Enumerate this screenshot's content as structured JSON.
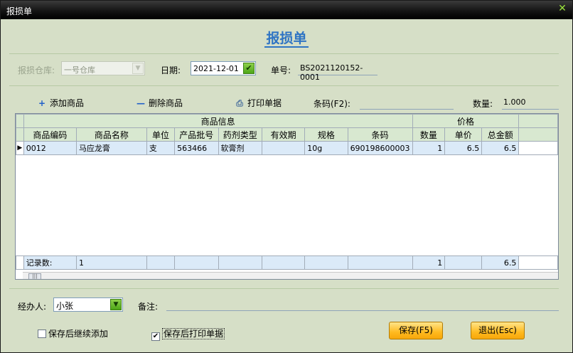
{
  "window": {
    "title": "报损单",
    "close_label": "✕"
  },
  "page_title": "报损单",
  "form": {
    "warehouse_label": "报损仓库:",
    "warehouse_value": "一号仓库",
    "date_label": "日期:",
    "date_value": "2021-12-01",
    "order_no_label": "单号:",
    "order_no_value": "BS2021120152-0001"
  },
  "toolbar": {
    "add_label": "添加商品",
    "delete_label": "删除商品",
    "print_label": "打印单据",
    "barcode_label": "条码(F2):",
    "barcode_value": "",
    "qty_label": "数量:",
    "qty_value": "1.000"
  },
  "grid": {
    "group_headers": {
      "info": "商品信息",
      "price": "价格"
    },
    "columns": [
      "商品编码",
      "商品名称",
      "单位",
      "产品批号",
      "药剂类型",
      "有效期",
      "规格",
      "条码",
      "数量",
      "单价",
      "总金额"
    ],
    "rows": [
      {
        "code": "0012",
        "name": "马应龙膏",
        "unit": "支",
        "batch": "563466",
        "type": "软膏剂",
        "expiry": "",
        "spec": "10g",
        "barcode": "690198600003",
        "qty": "1",
        "price": "6.5",
        "total": "6.5"
      }
    ],
    "footer": {
      "label": "记录数:",
      "count": "1",
      "qty_sum": "1",
      "total_sum": "6.5"
    }
  },
  "bottom": {
    "handler_label": "经办人:",
    "handler_value": "小张",
    "remark_label": "备注:",
    "remark_value": "",
    "chk_continue_label": "保存后继续添加",
    "chk_continue_checked": false,
    "chk_print_label": "保存后打印单据",
    "chk_print_checked": true,
    "save_label": "保存(F5)",
    "exit_label": "退出(Esc)"
  },
  "colors": {
    "title_blue": "#2e74c4",
    "dialog_bg": "#d6dfc7",
    "button_orange": "#ffba1f",
    "header_green": "#d8e8d0",
    "row_blue": "#dbeaf8"
  }
}
